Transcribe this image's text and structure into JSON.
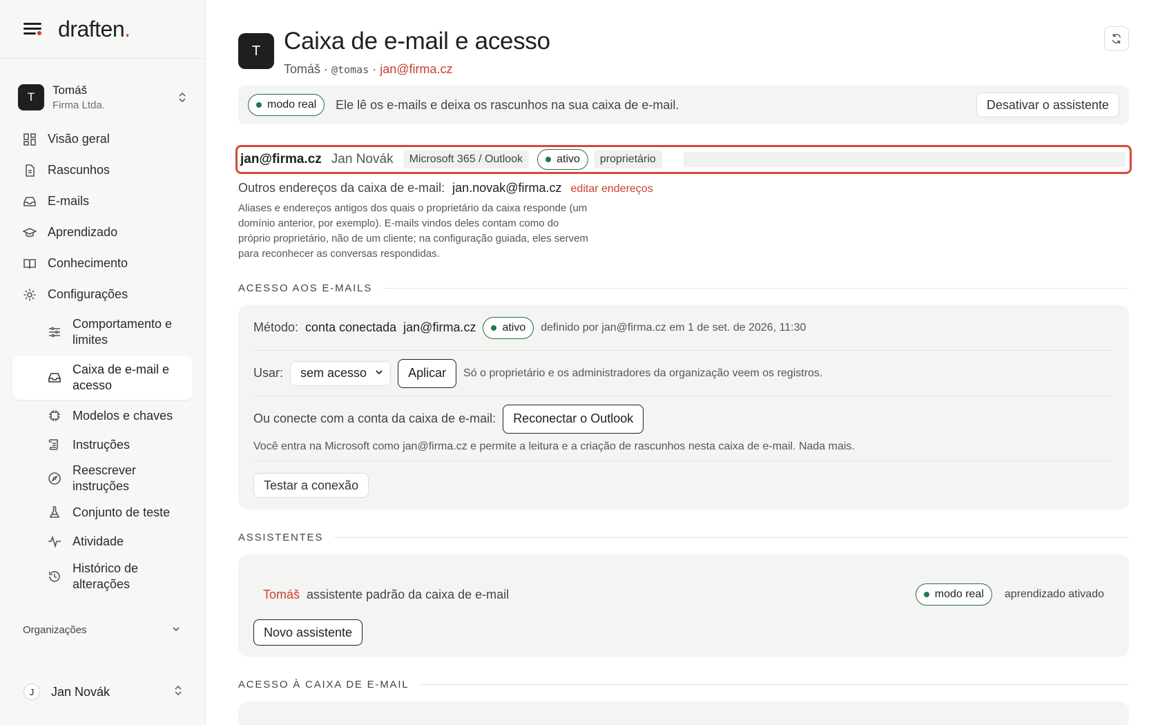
{
  "brand": {
    "logo_text": "draften",
    "logo_dot": "."
  },
  "account": {
    "initial": "T",
    "name": "Tomáš",
    "org": "Firma Ltda."
  },
  "nav": [
    {
      "label": "Visão geral",
      "icon": "grid-icon"
    },
    {
      "label": "Rascunhos",
      "icon": "document-icon"
    },
    {
      "label": "E-mails",
      "icon": "inbox-icon"
    },
    {
      "label": "Aprendizado",
      "icon": "graduation-icon"
    },
    {
      "label": "Conhecimento",
      "icon": "book-icon"
    },
    {
      "label": "Configurações",
      "icon": "gear-icon"
    }
  ],
  "subnav": [
    {
      "label": "Comportamento e limites",
      "icon": "sliders-icon"
    },
    {
      "label": "Caixa de e-mail e acesso",
      "icon": "inbox-icon"
    },
    {
      "label": "Modelos e chaves",
      "icon": "chip-icon"
    },
    {
      "label": "Instruções",
      "icon": "scroll-icon"
    },
    {
      "label": "Reescrever instruções",
      "icon": "compass-icon"
    },
    {
      "label": "Conjunto de teste",
      "icon": "flask-icon"
    },
    {
      "label": "Atividade",
      "icon": "activity-icon"
    },
    {
      "label": "Histórico de alterações",
      "icon": "history-icon"
    }
  ],
  "orgs_label": "Organizações",
  "user": {
    "initial": "J",
    "name": "Jan Novák"
  },
  "header": {
    "initial": "T",
    "title": "Caixa de e-mail e acesso",
    "owner": "Tomáš",
    "sep": "·",
    "handle": "@tomas",
    "email": "jan@firma.cz"
  },
  "banner": {
    "pill": "modo real",
    "text": "Ele lê os e-mails e deixa os rascunhos na sua caixa de e-mail.",
    "button": "Desativar o assistente"
  },
  "mailbox": {
    "email": "jan@firma.cz",
    "name": "Jan Novák",
    "provider": "Microsoft 365 / Outlook",
    "status": "ativo",
    "role": "proprietário"
  },
  "other_addresses": {
    "label": "Outros endereços da caixa de e-mail:",
    "value": "jan.novak@firma.cz",
    "edit": "editar endereços",
    "help": "Aliases e endereços antigos dos quais o proprietário da caixa responde (um domínio anterior, por exemplo). E-mails vindos deles contam como do próprio proprietário, não de um cliente; na configuração guiada, eles servem para reconhecer as conversas respondidas."
  },
  "access": {
    "heading": "ACESSO AOS E-MAILS",
    "method_label": "Método:",
    "method_value": "conta conectada",
    "method_email": "jan@firma.cz",
    "method_status": "ativo",
    "method_meta": "definido por jan@firma.cz em 1 de set. de 2026, 11:30",
    "use_label": "Usar:",
    "use_value": "sem acesso",
    "apply": "Aplicar",
    "use_note": "Só o proprietário e os administradores da organização veem os registros.",
    "connect_label": "Ou conecte com a conta da caixa de e-mail:",
    "reconnect": "Reconectar o Outlook",
    "connect_note": "Você entra na Microsoft como jan@firma.cz e permite a leitura e a criação de rascunhos nesta caixa de e-mail. Nada mais.",
    "test": "Testar a conexão"
  },
  "assistants": {
    "heading": "ASSISTENTES",
    "name": "Tomáš",
    "desc": "assistente padrão da caixa de e-mail",
    "pill": "modo real",
    "learning": "aprendizado ativado",
    "new": "Novo assistente"
  },
  "mailbox_access": {
    "heading": "ACESSO À CAIXA DE E-MAIL"
  },
  "colors": {
    "accent": "#c8402e",
    "status_green": "#1f7a49",
    "highlight": "#d9463a"
  }
}
